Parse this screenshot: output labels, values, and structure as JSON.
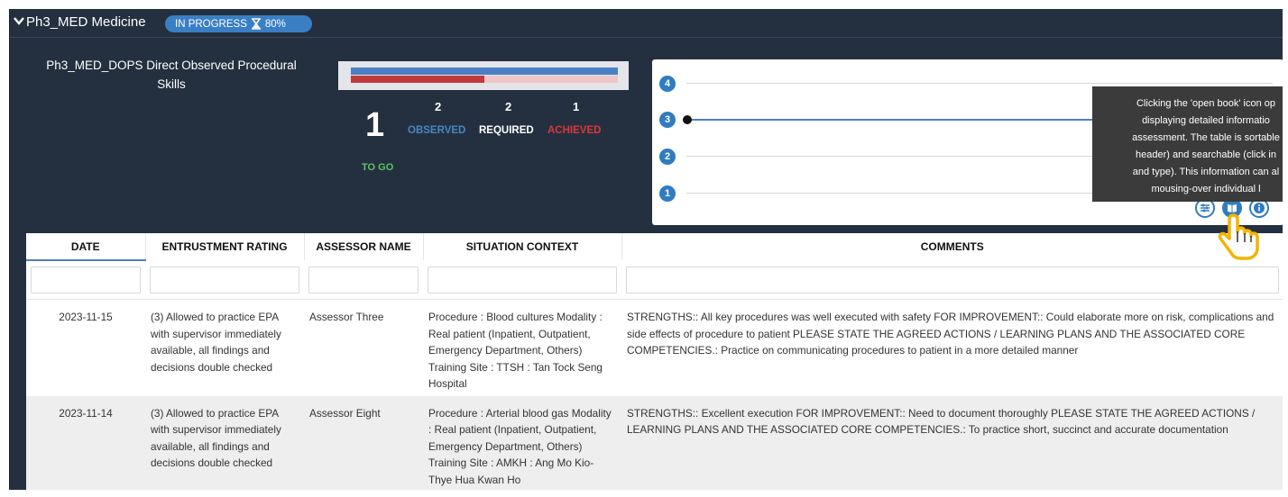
{
  "header": {
    "course_title": "Ph3_MED Medicine",
    "status_label": "IN PROGRESS",
    "progress_percent": 80,
    "progress_label": "80%"
  },
  "block": {
    "title": "Ph3_MED_DOPS Direct Observed Procedural Skills",
    "to_go_value": "1",
    "to_go_label": "TO GO",
    "observed_value": "2",
    "observed_label": "OBSERVED",
    "required_value": "2",
    "required_label": "REQUIRED",
    "achieved_value": "1",
    "achieved_label": "ACHIEVED",
    "bar_observed_fraction": 1.0,
    "bar_achieved_fraction": 0.5
  },
  "timeline": {
    "levels": [
      "4",
      "3",
      "2",
      "1"
    ],
    "current_level": "3"
  },
  "tooltip": {
    "lines": [
      "Clicking the 'open book' icon op",
      "displaying detailed informatio",
      "assessment. The table is sortable",
      "header) and searchable (click in",
      "and type). This information can al",
      "mousing-over individual l"
    ]
  },
  "table": {
    "columns": [
      "DATE",
      "ENTRUSTMENT RATING",
      "ASSESSOR NAME",
      "SITUATION CONTEXT",
      "COMMENTS"
    ],
    "rows": [
      {
        "date": "2023-11-15",
        "rating": "(3) Allowed to practice EPA with supervisor immediately available, all findings and decisions double checked",
        "assessor": "Assessor Three",
        "context": "Procedure : Blood cultures Modality : Real patient (Inpatient, Outpatient, Emergency Department, Others) Training Site : TTSH : Tan Tock Seng Hospital",
        "comments": "STRENGTHS:: All key procedures was well executed with safety FOR IMPROVEMENT:: Could elaborate more on risk, complications and side effects of procedure to patient PLEASE STATE THE AGREED ACTIONS / LEARNING PLANS AND THE ASSOCIATED CORE COMPETENCIES.: Practice on communicating procedures to patient in a more detailed manner"
      },
      {
        "date": "2023-11-14",
        "rating": "(3) Allowed to practice EPA with supervisor immediately available, all findings and decisions double checked",
        "assessor": "Assessor Eight",
        "context": "Procedure : Arterial blood gas Modality : Real patient (Inpatient, Outpatient, Emergency Department, Others) Training Site : AMKH : Ang Mo Kio-Thye Hua Kwan Ho",
        "comments": "STRENGTHS:: Excellent execution FOR IMPROVEMENT:: Need to document thoroughly PLEASE STATE THE AGREED ACTIONS / LEARNING PLANS AND THE ASSOCIATED CORE COMPETENCIES.: To practice short, succinct and accurate documentation"
      }
    ]
  },
  "colors": {
    "background": "#24303f",
    "accent_blue": "#2f7cc0",
    "observed_blue": "#4a80c3",
    "achieved_red": "#c0393b",
    "to_go_green": "#5cc464"
  },
  "icons": {
    "collapse": "chevron-down-icon",
    "progress": "hourglass-icon",
    "settings": "sliders-icon",
    "details": "open-book-icon",
    "info": "info-icon",
    "cursor": "hand-pointer-icon"
  }
}
